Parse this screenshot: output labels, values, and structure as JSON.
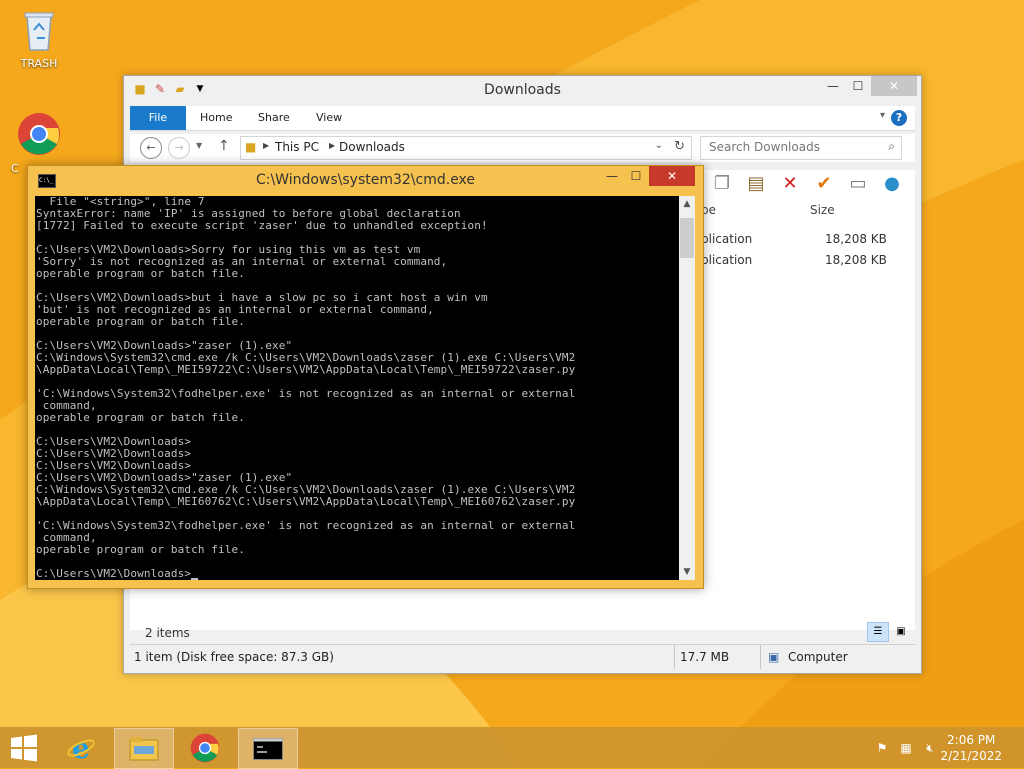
{
  "desktop": {
    "icons": [
      {
        "label": "TRASH",
        "icon": "recycle-bin-icon"
      },
      {
        "label": "C",
        "icon": "chrome-icon"
      }
    ]
  },
  "explorer": {
    "title": "Downloads",
    "window_buttons": {
      "minimize": "—",
      "maximize": "☐",
      "close": "✕"
    },
    "ribbon_tabs": [
      "File",
      "Home",
      "Share",
      "View"
    ],
    "help": "?",
    "breadcrumb": [
      "This PC",
      "Downloads"
    ],
    "search_placeholder": "Search Downloads",
    "columns": {
      "type": "pe",
      "size": "Size"
    },
    "files": [
      {
        "type": "plication",
        "size": "18,208 KB"
      },
      {
        "type": "plication",
        "size": "18,208 KB"
      }
    ],
    "items_count": "2 items",
    "status": {
      "selection": "1 item (Disk free space: 87.3 GB)",
      "size": "17.7 MB",
      "location": "Computer"
    }
  },
  "cmd": {
    "title": "C:\\Windows\\system32\\cmd.exe",
    "icon_text": "C:\\_",
    "window_buttons": {
      "minimize": "—",
      "maximize": "☐",
      "close": "✕"
    },
    "console_text": "  File \"<string>\", line 7\nSyntaxError: name 'IP' is assigned to before global declaration\n[1772] Failed to execute script 'zaser' due to unhandled exception!\n\nC:\\Users\\VM2\\Downloads>Sorry for using this vm as test vm\n'Sorry' is not recognized as an internal or external command,\noperable program or batch file.\n\nC:\\Users\\VM2\\Downloads>but i have a slow pc so i cant host a win vm\n'but' is not recognized as an internal or external command,\noperable program or batch file.\n\nC:\\Users\\VM2\\Downloads>\"zaser (1).exe\"\nC:\\Windows\\System32\\cmd.exe /k C:\\Users\\VM2\\Downloads\\zaser (1).exe C:\\Users\\VM2\n\\AppData\\Local\\Temp\\_MEI59722\\C:\\Users\\VM2\\AppData\\Local\\Temp\\_MEI59722\\zaser.py\n\n'C:\\Windows\\System32\\fodhelper.exe' is not recognized as an internal or external\n command,\noperable program or batch file.\n\nC:\\Users\\VM2\\Downloads>\nC:\\Users\\VM2\\Downloads>\nC:\\Users\\VM2\\Downloads>\nC:\\Users\\VM2\\Downloads>\"zaser (1).exe\"\nC:\\Windows\\System32\\cmd.exe /k C:\\Users\\VM2\\Downloads\\zaser (1).exe C:\\Users\\VM2\n\\AppData\\Local\\Temp\\_MEI60762\\C:\\Users\\VM2\\AppData\\Local\\Temp\\_MEI60762\\zaser.py\n\n'C:\\Windows\\System32\\fodhelper.exe' is not recognized as an internal or external\n command,\noperable program or batch file.\n\nC:\\Users\\VM2\\Downloads>"
  },
  "taskbar": {
    "apps": [
      "start-icon",
      "internet-explorer-icon",
      "file-explorer-icon",
      "chrome-icon",
      "cmd-icon"
    ],
    "clock_time": "2:06 PM",
    "clock_date": "2/21/2022"
  },
  "colors": {
    "desktop": "#f5a81c",
    "cmd_frame": "#f6c24f",
    "accent_blue": "#1979ca"
  }
}
